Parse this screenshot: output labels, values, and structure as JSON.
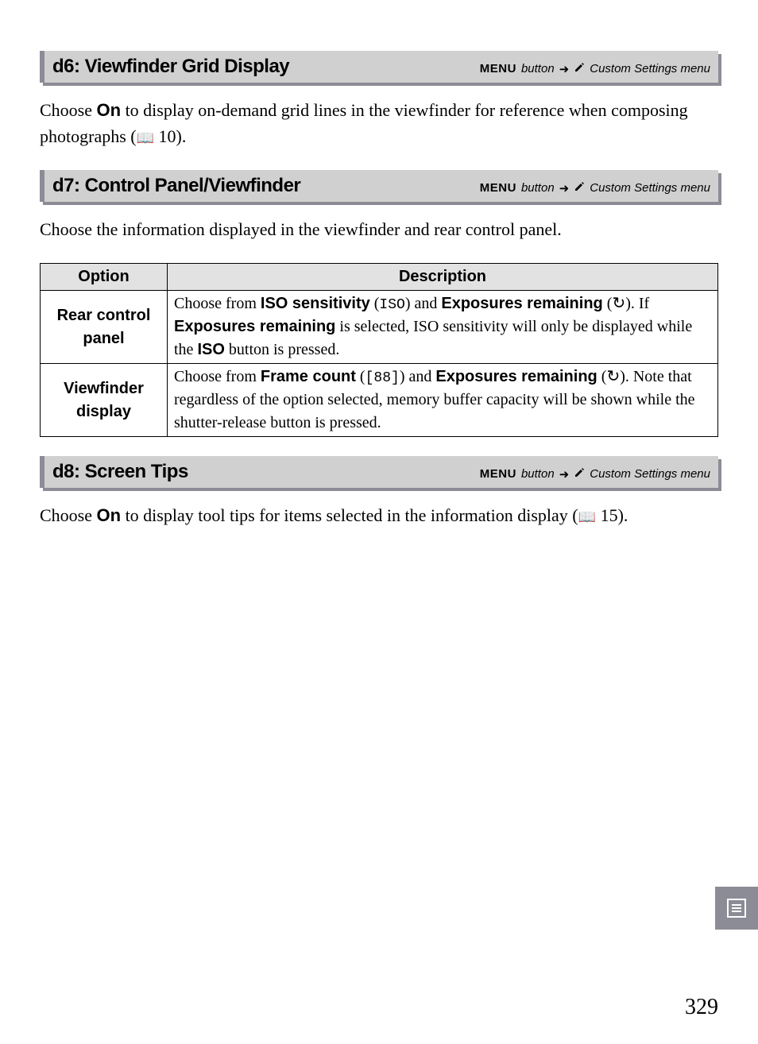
{
  "breadcrumb": {
    "menu_label": "MENU",
    "button_word": "button",
    "arrow": "➜",
    "menu_name": "Custom Settings menu"
  },
  "sections": {
    "d6": {
      "title": "d6: Viewfinder Grid Display",
      "body_pre": "Choose ",
      "body_bold_on": "On",
      "body_mid": " to display on-demand grid lines in the viewfinder for reference when composing photographs (",
      "body_ref": "10",
      "body_post": ")."
    },
    "d7": {
      "title": "d7: Control Panel/Viewfinder",
      "body": "Choose the information displayed in the viewfinder and rear control panel.",
      "table": {
        "col_option": "Option",
        "col_desc": "Description",
        "rows": [
          {
            "option_l1": "Rear control",
            "option_l2": "panel",
            "d_t1": "Choose from ",
            "d_b1": "ISO sensitivity",
            "d_t2": " (",
            "d_lcd1": "ISO",
            "d_t3": ") and ",
            "d_b2": "Exposures remaining",
            "d_t4": " (",
            "d_sym1": "↻",
            "d_t5": "). If ",
            "d_b3": "Exposures remaining",
            "d_t6": " is selected, ISO sensitivity will only be displayed while the ",
            "d_b4": "ISO",
            "d_t7": " button is pressed."
          },
          {
            "option_l1": "Viewfinder",
            "option_l2": "display",
            "d_t1": "Choose from ",
            "d_b1": "Frame count",
            "d_t2": " (",
            "d_lcd1": "[88]",
            "d_t3": ") and ",
            "d_b2": "Exposures remaining",
            "d_t4": " (",
            "d_sym1": "↻",
            "d_t5": "). Note that regardless of the option selected, memory buffer capacity will be shown while the shutter-release button is pressed.",
            "d_b3": "",
            "d_t6": "",
            "d_b4": "",
            "d_t7": ""
          }
        ]
      }
    },
    "d8": {
      "title": "d8: Screen Tips",
      "body_pre": "Choose ",
      "body_bold_on": "On",
      "body_mid": " to display tool tips for items selected in the information display (",
      "body_ref": "15",
      "body_post": ")."
    }
  },
  "page_number": "329"
}
